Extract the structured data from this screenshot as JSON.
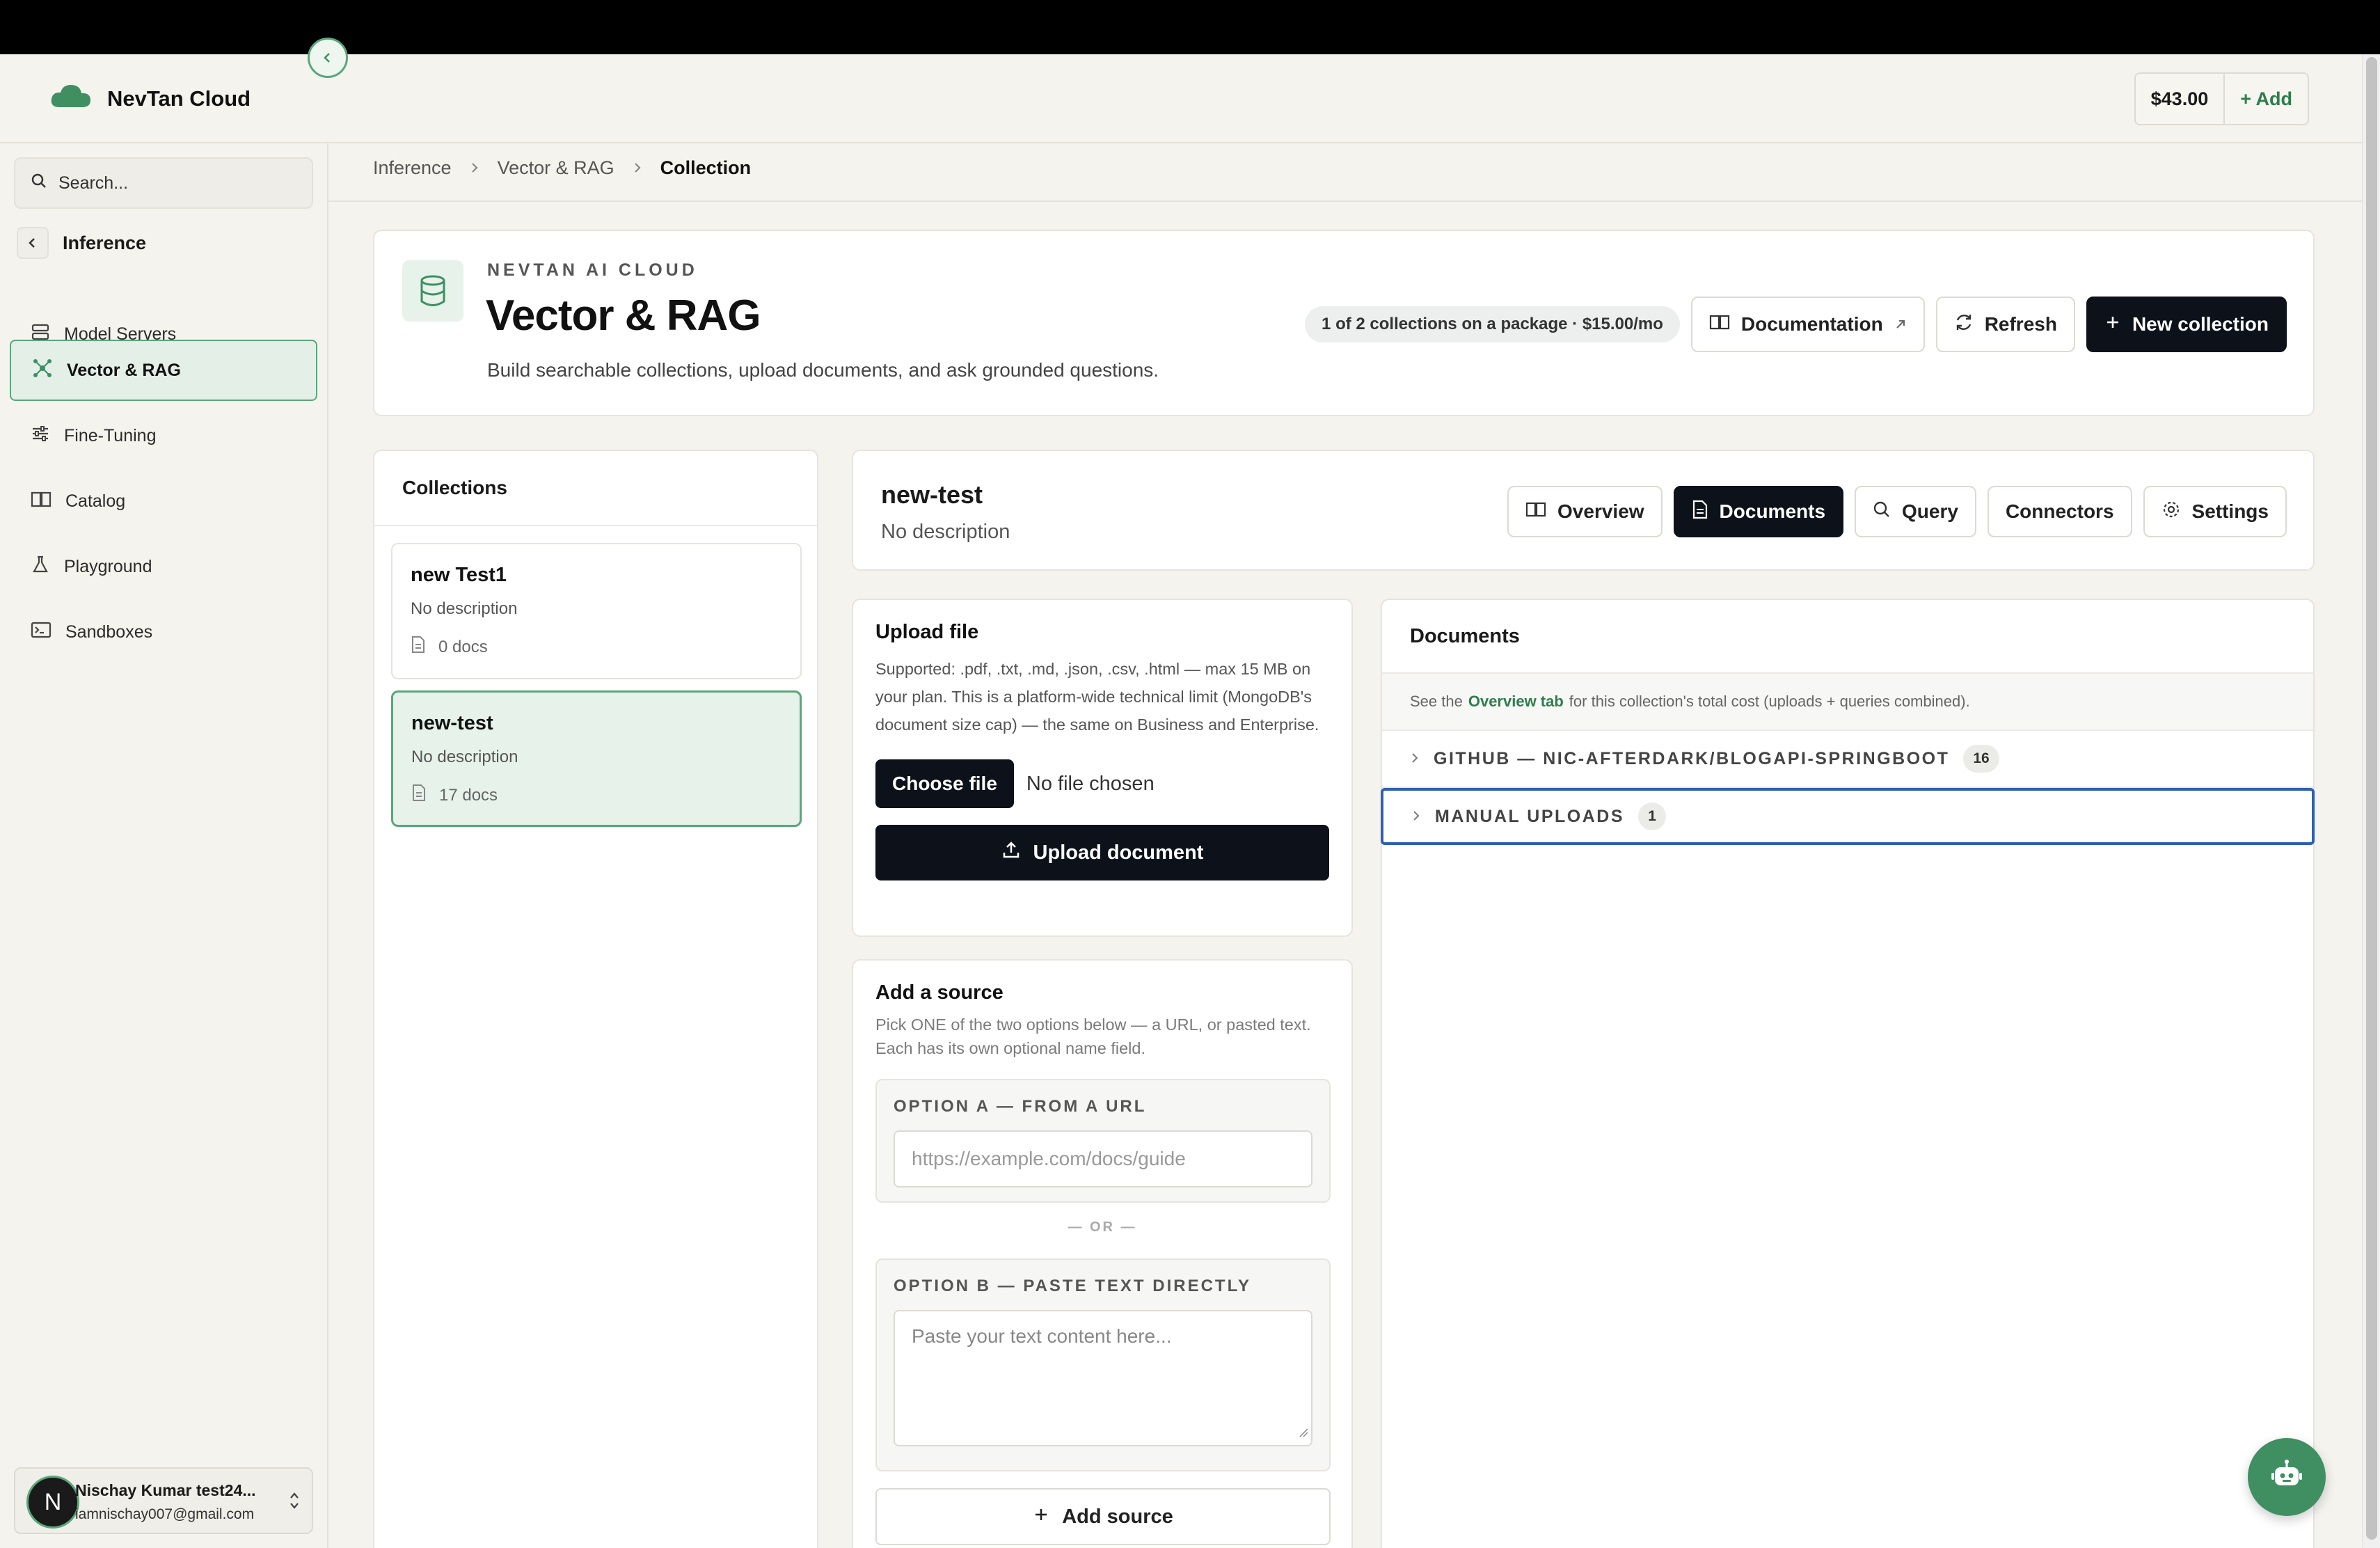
{
  "brand": {
    "name": "NevTan Cloud"
  },
  "header": {
    "balance": "$43.00",
    "add_label": "+ Add"
  },
  "sidebar": {
    "search_placeholder": "Search...",
    "back_label": "Inference",
    "items": [
      {
        "label": "Model Servers",
        "icon": "server-icon"
      },
      {
        "label": "Vector & RAG",
        "icon": "network-icon",
        "active": true
      },
      {
        "label": "Fine-Tuning",
        "icon": "sliders-icon"
      },
      {
        "label": "Catalog",
        "icon": "book-icon"
      },
      {
        "label": "Playground",
        "icon": "flask-icon"
      },
      {
        "label": "Sandboxes",
        "icon": "terminal-icon"
      }
    ],
    "user": {
      "initial": "N",
      "name": "Nischay Kumar test24...",
      "email": "iamnischay007@gmail.com"
    }
  },
  "breadcrumb": [
    "Inference",
    "Vector & RAG",
    "Collection"
  ],
  "hero": {
    "eyebrow": "NEVTAN AI CLOUD",
    "title": "Vector & RAG",
    "subtitle": "Build searchable collections, upload documents, and ask grounded questions.",
    "package_note": "1 of 2 collections on a package · $15.00/mo",
    "documentation_label": "Documentation",
    "refresh_label": "Refresh",
    "new_collection_label": "New collection"
  },
  "collections": {
    "heading": "Collections",
    "items": [
      {
        "name": "new Test1",
        "description": "No description",
        "docs": "0 docs"
      },
      {
        "name": "new-test",
        "description": "No description",
        "docs": "17 docs",
        "selected": true
      }
    ]
  },
  "detail": {
    "name": "new-test",
    "description": "No description",
    "tabs": [
      {
        "label": "Overview",
        "icon": "book-icon"
      },
      {
        "label": "Documents",
        "icon": "file-icon",
        "active": true
      },
      {
        "label": "Query",
        "icon": "search-icon"
      },
      {
        "label": "Connectors",
        "icon": ""
      },
      {
        "label": "Settings",
        "icon": "gear-icon"
      }
    ]
  },
  "upload": {
    "title": "Upload file",
    "help": "Supported: .pdf, .txt, .md, .json, .csv, .html — max 15 MB on your plan. This is a platform-wide technical limit (MongoDB's document size cap) — the same on Business and Enterprise.",
    "choose_label": "Choose file",
    "no_file": "No file chosen",
    "upload_label": "Upload document"
  },
  "source": {
    "title": "Add a source",
    "help": "Pick ONE of the two options below — a URL, or pasted text. Each has its own optional name field.",
    "option_a_label": "OPTION A — FROM A URL",
    "url_placeholder": "https://example.com/docs/guide",
    "or_label": "— OR —",
    "option_b_label": "OPTION B — PASTE TEXT DIRECTLY",
    "text_placeholder": "Paste your text content here...",
    "add_label": "Add source"
  },
  "documents": {
    "heading": "Documents",
    "note_prefix": "See the",
    "note_link": "Overview tab",
    "note_suffix": "for this collection's total cost (uploads + queries combined).",
    "groups": [
      {
        "label": "GITHUB — NIC-AFTERDARK/BLOGAPI-SPRINGBOOT",
        "count": "16"
      },
      {
        "label": "MANUAL UPLOADS",
        "count": "1"
      }
    ]
  },
  "colors": {
    "accent": "#5aa67b",
    "primary": "#0d111a",
    "focus": "#2f5fb0"
  }
}
